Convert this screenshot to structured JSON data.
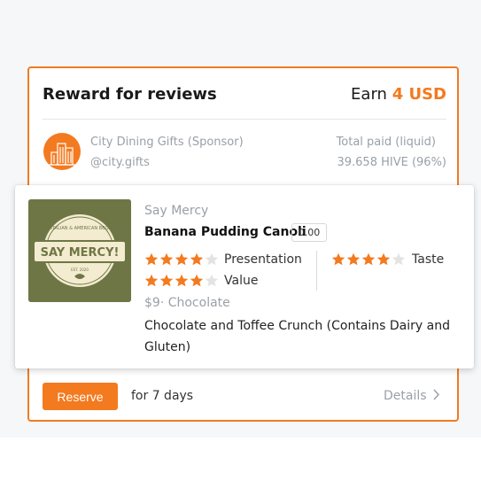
{
  "card": {
    "title": "Reward for reviews",
    "earn_prefix": "Earn",
    "earn_amount": "4 USD",
    "accent_color": "#f37a1f"
  },
  "sponsor": {
    "name": "City Dining Gifts (Sponsor)",
    "handle": "@city.gifts",
    "paid_label": "Total paid (liquid)",
    "paid_value": "39.658 HIVE (96%)",
    "logo_icon": "city-buildings-icon"
  },
  "item": {
    "restaurant": "Say Mercy",
    "dish": "Banana Pudding Canoli",
    "badge": "0.00",
    "logo_text": "SAY MERCY!",
    "logo_small_top": "ITALIAN & AMERICAN BBQ",
    "logo_small_bottom": "EST. 2020",
    "ratings": [
      {
        "label": "Presentation",
        "stars": 4,
        "max": 5
      },
      {
        "label": "Taste",
        "stars": 4,
        "max": 5
      },
      {
        "label": "Value",
        "stars": 4,
        "max": 5
      }
    ],
    "price_line": "$9· Chocolate",
    "description": "Chocolate and Toffee Crunch (Contains Dairy and Gluten)"
  },
  "footer": {
    "reserve_label": "Reserve",
    "duration": "for 7 days",
    "details_label": "Details",
    "details_icon": "chevron-right-icon"
  }
}
